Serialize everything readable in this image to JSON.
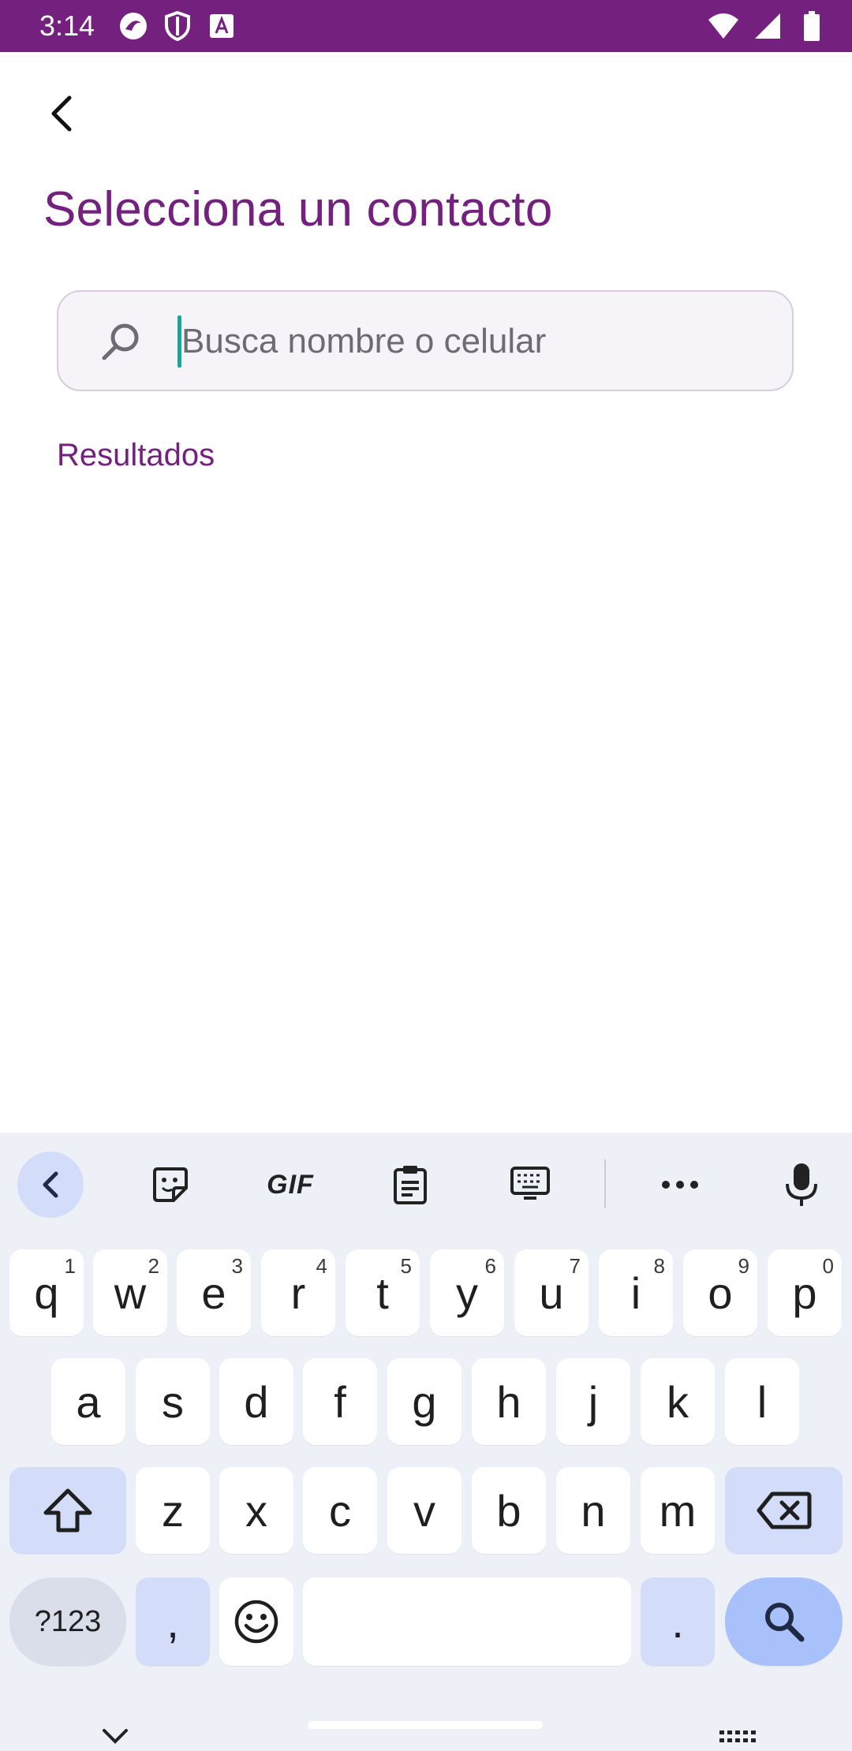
{
  "status_bar": {
    "time": "3:14",
    "left_icons": [
      "app-icon",
      "shield-icon",
      "font-icon"
    ],
    "right_icons": [
      "wifi-icon",
      "signal-icon",
      "battery-icon"
    ],
    "bg_color": "#74207f"
  },
  "header": {
    "back_icon": "back-arrow-icon",
    "title": "Selecciona un contacto"
  },
  "search": {
    "placeholder": "Busca nombre o celular",
    "value": "",
    "icon": "search-icon"
  },
  "results": {
    "label": "Resultados"
  },
  "keyboard": {
    "toolbar": [
      "collapse-icon",
      "sticker-icon",
      "gif-icon",
      "clipboard-icon",
      "keyboard-layout-icon",
      "more-icon",
      "mic-icon"
    ],
    "gif_label": "GIF",
    "rows": [
      [
        {
          "k": "q",
          "h": "1"
        },
        {
          "k": "w",
          "h": "2"
        },
        {
          "k": "e",
          "h": "3"
        },
        {
          "k": "r",
          "h": "4"
        },
        {
          "k": "t",
          "h": "5"
        },
        {
          "k": "y",
          "h": "6"
        },
        {
          "k": "u",
          "h": "7"
        },
        {
          "k": "i",
          "h": "8"
        },
        {
          "k": "o",
          "h": "9"
        },
        {
          "k": "p",
          "h": "0"
        }
      ],
      [
        {
          "k": "a"
        },
        {
          "k": "s"
        },
        {
          "k": "d"
        },
        {
          "k": "f"
        },
        {
          "k": "g"
        },
        {
          "k": "h"
        },
        {
          "k": "j"
        },
        {
          "k": "k"
        },
        {
          "k": "l"
        }
      ],
      [
        {
          "k": "z"
        },
        {
          "k": "x"
        },
        {
          "k": "c"
        },
        {
          "k": "v"
        },
        {
          "k": "b"
        },
        {
          "k": "n"
        },
        {
          "k": "m"
        }
      ]
    ],
    "symbols_label": "?123",
    "comma": ",",
    "period": ".",
    "accent_color": "#a9c1fb"
  }
}
